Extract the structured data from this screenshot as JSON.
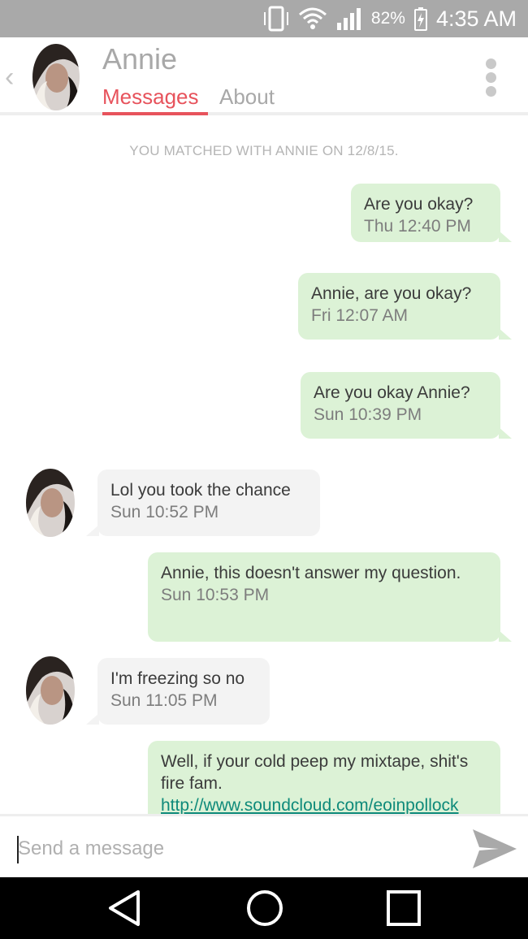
{
  "status_bar": {
    "battery_percent": "82%",
    "time": "4:35 AM",
    "icons": [
      "vibrate-icon",
      "wifi-icon",
      "signal-icon",
      "battery-charging-icon"
    ],
    "background": "#a9a9a9"
  },
  "header": {
    "name": "Annie",
    "tabs": [
      {
        "label": "Messages",
        "active": true
      },
      {
        "label": "About",
        "active": false
      }
    ],
    "accent": "#e7535c"
  },
  "chat": {
    "matched_text": "YOU MATCHED WITH ANNIE ON 12/8/15.",
    "messages": [
      {
        "from": "me",
        "text": "Are you okay?",
        "time": "Thu 12:40 PM"
      },
      {
        "from": "me",
        "text": "Annie, are you okay?",
        "time": "Fri 12:07 AM"
      },
      {
        "from": "me",
        "text": "Are you okay Annie?",
        "time": "Sun 10:39 PM"
      },
      {
        "from": "annie",
        "text": "Lol you took the chance",
        "time": "Sun 10:52 PM"
      },
      {
        "from": "me",
        "text": "Annie, this doesn't answer my question.",
        "time": "Sun 10:53 PM"
      },
      {
        "from": "annie",
        "text": "I'm freezing so no",
        "time": "Sun 11:05 PM"
      },
      {
        "from": "me",
        "text": "Well, if your cold peep my mixtape, shit's fire fam.",
        "link": "http://www.soundcloud.com/eoinpollock"
      }
    ],
    "outgoing_color": "#dcf2d6",
    "incoming_color": "#f3f3f3"
  },
  "composer": {
    "placeholder": "Send a message",
    "value": ""
  },
  "nav_bar": {
    "icons": [
      "back-triangle-icon",
      "home-circle-icon",
      "recents-square-icon"
    ]
  }
}
